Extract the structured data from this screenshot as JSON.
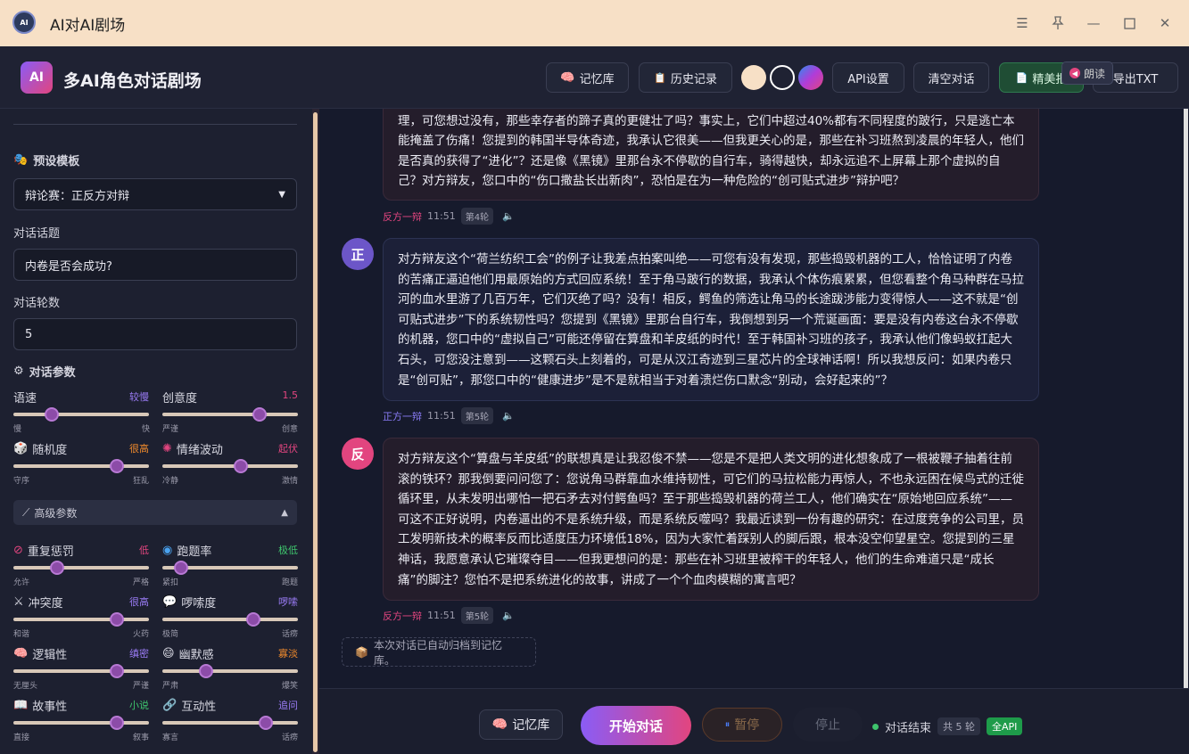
{
  "window": {
    "title": "AI对AI剧场",
    "logo_text": "AI"
  },
  "header": {
    "logo_text": "AI",
    "title": "多AI角色对话剧场",
    "buttons": {
      "memory": "记忆库",
      "history": "历史记录",
      "api": "API设置",
      "clear": "清空对话",
      "premium": "精美报",
      "export": "导出TXT"
    },
    "swatch_colors": [
      "#f7e0c6",
      "#1f2233",
      "#8a5cf6"
    ],
    "tooltip": "朗读"
  },
  "sidebar": {
    "template_label": "预设模板",
    "template_value": "辩论赛：正反方对辩",
    "topic_label": "对话话题",
    "topic_value": "内卷是否会成功?",
    "rounds_label": "对话轮数",
    "rounds_value": "5",
    "params_label": "对话参数",
    "params": [
      {
        "name": "语速",
        "value": "较慢",
        "color": "#9b7cf6",
        "min": "慢",
        "max": "快",
        "level": 0.28
      },
      {
        "name": "创意度",
        "value": "1.5",
        "color": "#e2457f",
        "min": "严谨",
        "max": "创意",
        "level": 0.72
      },
      {
        "name": "随机度",
        "value": "很高",
        "color": "#f08a2c",
        "min": "守序",
        "max": "狂乱",
        "level": 0.76
      },
      {
        "name": "情绪波动",
        "value": "起伏",
        "color": "#e2457f",
        "min": "冷静",
        "max": "激情",
        "level": 0.58
      }
    ],
    "advanced_label": "高级参数",
    "advanced": [
      {
        "name": "重复惩罚",
        "value": "低",
        "color": "#e2457f",
        "min": "允许",
        "max": "严格",
        "level": 0.32
      },
      {
        "name": "跑题率",
        "value": "极低",
        "color": "#3ec46d",
        "min": "紧扣",
        "max": "跑题",
        "level": 0.14
      },
      {
        "name": "冲突度",
        "value": "很高",
        "color": "#9b7cf6",
        "min": "和谐",
        "max": "火药",
        "level": 0.76
      },
      {
        "name": "啰嗦度",
        "value": "啰嗦",
        "color": "#9b7cf6",
        "min": "极简",
        "max": "话痨",
        "level": 0.67
      },
      {
        "name": "逻辑性",
        "value": "缜密",
        "color": "#9b7cf6",
        "min": "无厘头",
        "max": "严谨",
        "level": 0.76
      },
      {
        "name": "幽默感",
        "value": "寡淡",
        "color": "#f08a2c",
        "min": "严肃",
        "max": "爆笑",
        "level": 0.32
      },
      {
        "name": "故事性",
        "value": "小说",
        "color": "#3ec46d",
        "min": "直接",
        "max": "叙事",
        "level": 0.76
      },
      {
        "name": "互动性",
        "value": "追问",
        "color": "#9b7cf6",
        "min": "寡言",
        "max": "话痨",
        "level": 0.76
      }
    ]
  },
  "messages": [
    {
      "side": "con",
      "avatar": "反",
      "text": "理，可您想过没有，那些幸存者的蹄子真的更健壮了吗？事实上，它们中超过40%都有不同程度的跛行，只是逃亡本能掩盖了伤痛！您提到的韩国半导体奇迹，我承认它很美——但我更关心的是，那些在补习班熬到凌晨的年轻人，他们是否真的获得了“进化”？还是像《黑镜》里那台永不停歇的自行车，骑得越快，却永远追不上屏幕上那个虚拟的自己？对方辩友，您口中的“伤口撒盐长出新肉”，恐怕是在为一种危险的“创可贴式进步”辩护吧？",
      "speaker": "反方一辩",
      "time": "11:51",
      "round": "第4轮"
    },
    {
      "side": "pro",
      "avatar": "正",
      "text": "对方辩友这个“荷兰纺织工会”的例子让我差点拍案叫绝——可您有没有发现，那些捣毁机器的工人，恰恰证明了内卷的苦痛正逼迫他们用最原始的方式回应系统！至于角马跛行的数据，我承认个体伤痕累累，但您看整个角马种群在马拉河的血水里游了几百万年，它们灭绝了吗？没有！相反，鳄鱼的筛选让角马的长途跋涉能力变得惊人——这不就是“创可贴式进步”下的系统韧性吗？您提到《黑镜》里那台自行车，我倒想到另一个荒诞画面：要是没有内卷这台永不停歇的机器，您口中的“虚拟自己”可能还停留在算盘和羊皮纸的时代！至于韩国补习班的孩子，我承认他们像蚂蚁扛起大石头，可您没注意到——这颗石头上刻着的，可是从汉江奇迹到三星芯片的全球神话啊！所以我想反问：如果内卷只是“创可贴”，那您口中的“健康进步”是不是就相当于对着溃烂伤口默念“别动，会好起来的”？",
      "speaker": "正方一辩",
      "time": "11:51",
      "round": "第5轮"
    },
    {
      "side": "con",
      "avatar": "反",
      "text": "对方辩友这个“算盘与羊皮纸”的联想真是让我忍俊不禁——您是不是把人类文明的进化想象成了一根被鞭子抽着往前滚的铁环？那我倒要问问您了：您说角马群靠血水维持韧性，可它们的马拉松能力再惊人，不也永远困在候鸟式的迁徙循环里，从未发明出哪怕一把石矛去对付鳄鱼吗？至于那些捣毁机器的荷兰工人，他们确实在“原始地回应系统”——可这不正好说明，内卷逼出的不是系统升级，而是系统反噬吗？我最近读到一份有趣的研究：在过度竞争的公司里，员工发明新技术的概率反而比适度压力环境低18%，因为大家忙着踩别人的脚后跟，根本没空仰望星空。您提到的三星神话，我愿意承认它璀璨夺目——但我更想问的是：那些在补习班里被榨干的年轻人，他们的生命难道只是“成长痛”的脚注？您怕不是把系统进化的故事，讲成了一个个血肉模糊的寓言吧？",
      "speaker": "反方一辩",
      "time": "11:51",
      "round": "第5轮"
    }
  ],
  "archive_note": "本次对话已自动归档到记忆库。",
  "footer": {
    "memory": "记忆库",
    "start": "开始对话",
    "pause": "暂停",
    "stop": "停止",
    "status": "对话结束",
    "rounds": "共 5 轮",
    "api": "全API"
  }
}
